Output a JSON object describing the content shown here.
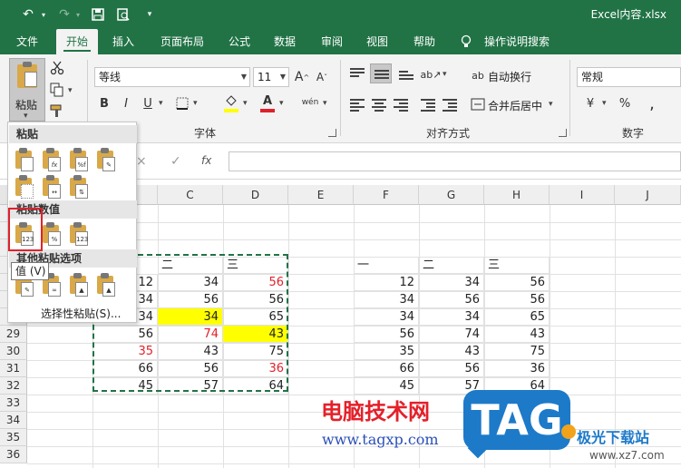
{
  "titlebar": {
    "undo_icon": "undo-icon",
    "redo_icon": "redo-icon",
    "save_icon": "save-icon",
    "preview_icon": "print-preview-icon",
    "customize_icon": "customize-qa-icon",
    "title": "Excel内容.xlsx"
  },
  "tabs": [
    "文件",
    "开始",
    "插入",
    "页面布局",
    "公式",
    "数据",
    "审阅",
    "视图",
    "帮助",
    "操作说明搜索"
  ],
  "ribbon": {
    "paste_label": "粘贴",
    "font_name": "等线",
    "font_size": "11",
    "grow_font": "A",
    "shrink_font": "A",
    "bold": "B",
    "italic": "I",
    "underline": "U",
    "font_color_letter": "A",
    "phonetic": "wén",
    "font_group": "字体",
    "wrap_text": "自动换行",
    "merge_center": "合并后居中",
    "alignment_group": "对齐方式",
    "number_format": "常规",
    "currency": "¥",
    "percent": "%",
    "comma": ",",
    "number_group": "数字",
    "colors": {
      "fill": "#ffff00",
      "font": "#e0212b"
    }
  },
  "formula_bar": {
    "cancel": "×",
    "enter": "✓",
    "fx": "fx"
  },
  "columns": [
    "C",
    "D",
    "E",
    "F",
    "G",
    "H",
    "I",
    "J"
  ],
  "rows": [
    "29",
    "30",
    "31",
    "32",
    "33",
    "34",
    "35",
    "36"
  ],
  "table_left": {
    "headers": [
      "二",
      "三"
    ],
    "rows": [
      [
        "12",
        "34",
        "56"
      ],
      [
        "34",
        "56",
        "56"
      ],
      [
        "34",
        "34",
        "65"
      ],
      [
        "56",
        "74",
        "43"
      ],
      [
        "35",
        "43",
        "75"
      ],
      [
        "66",
        "56",
        "36"
      ],
      [
        "45",
        "57",
        "64"
      ]
    ]
  },
  "table_right": {
    "headers": [
      "一",
      "二",
      "三"
    ],
    "rows": [
      [
        "12",
        "34",
        "56"
      ],
      [
        "34",
        "56",
        "56"
      ],
      [
        "34",
        "34",
        "65"
      ],
      [
        "56",
        "74",
        "43"
      ],
      [
        "35",
        "43",
        "75"
      ],
      [
        "66",
        "56",
        "36"
      ],
      [
        "45",
        "57",
        "64"
      ]
    ]
  },
  "paste_menu": {
    "section_paste": "粘贴",
    "section_values": "粘贴数值",
    "section_other": "其他粘贴选项",
    "special": "选择性粘贴(S)...",
    "value_badge": "123",
    "percent_badge": "%",
    "tooltip": "值 (V)"
  },
  "watermark": {
    "cn_text": "电脑技术网",
    "url": "www.tagxp.com",
    "tag": "TAG",
    "brand": "极光下载站",
    "brand_url": "www.xz7.com"
  }
}
